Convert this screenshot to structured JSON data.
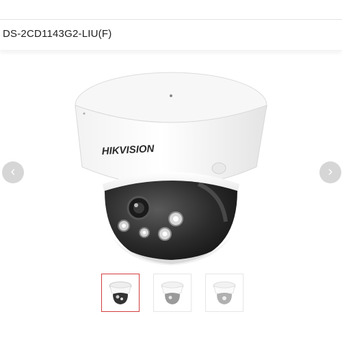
{
  "header": {
    "product_title": "DS-2CD1143G2-LIU(F)"
  },
  "gallery": {
    "main_image": {
      "brand_text": "HIKVISION"
    },
    "nav": {
      "prev_icon": "chevron-left-icon",
      "next_icon": "chevron-right-icon"
    },
    "thumbnails": [
      {
        "name": "thumbnail-front",
        "active": true
      },
      {
        "name": "thumbnail-side",
        "active": false
      },
      {
        "name": "thumbnail-alt",
        "active": false
      }
    ]
  },
  "colors": {
    "active_thumb_border": "#d23b3b",
    "nav_button": "#d6d6d6"
  }
}
